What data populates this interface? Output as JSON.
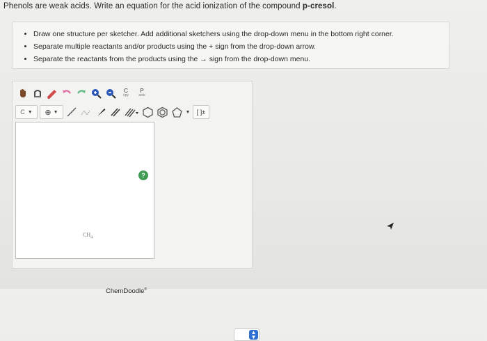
{
  "question": {
    "prefix": "Phenols are weak acids. Write an equation for the acid ionization of the compound ",
    "compound": "p-cresol",
    "suffix": "."
  },
  "instructions": [
    "Draw one structure per sketcher. Add additional sketchers using the drop-down menu in the bottom right corner.",
    "Separate multiple reactants and/or products using the + sign from the drop-down arrow.",
    "Separate the reactants from the products using the → sign from the drop-down menu."
  ],
  "toolbar": {
    "copy_label": "C",
    "copy_sub": "opy",
    "paste_label": "P",
    "paste_sub": "aste",
    "element_select": "C",
    "bracket_label": "[ ]±"
  },
  "canvas": {
    "placeholder_formula": "CH4",
    "brand": "ChemDoodle",
    "brand_mark": "®",
    "help_label": "?"
  },
  "colors": {
    "accent": "#2f6fd2",
    "help": "#3f9b53",
    "erase": "#d24a4a",
    "zoom": "#2b57b8"
  }
}
